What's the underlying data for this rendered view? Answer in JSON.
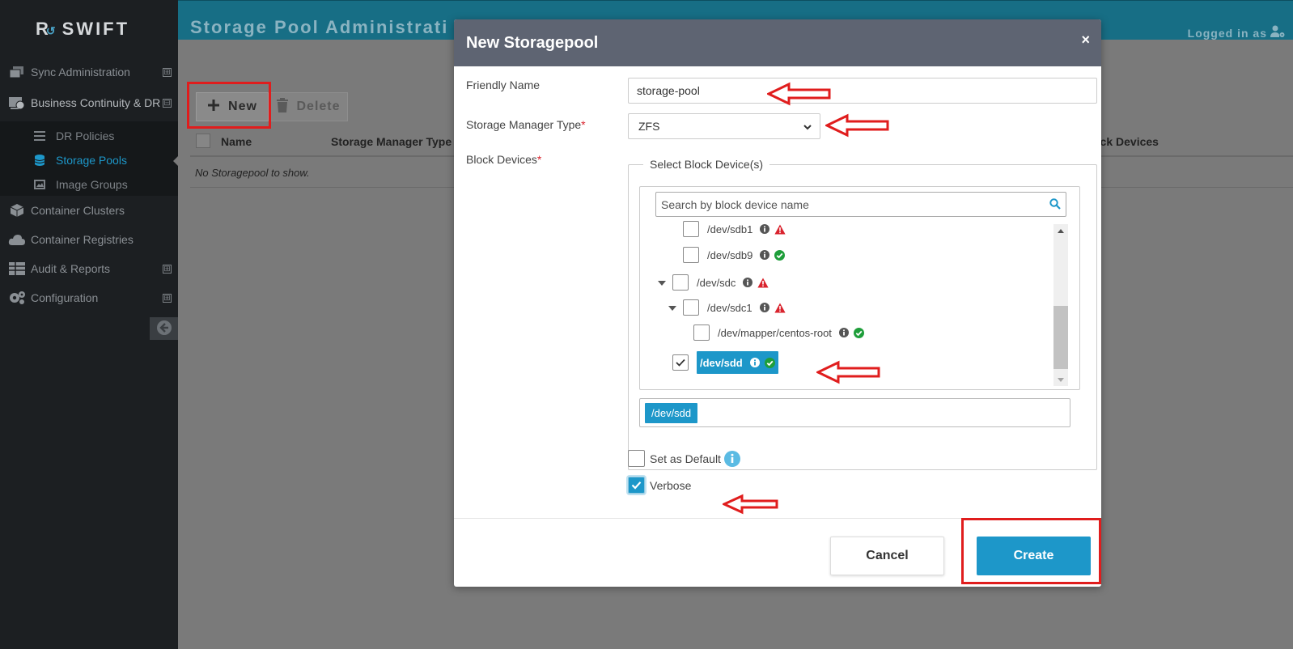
{
  "app": {
    "logo_text": "SWIFT",
    "logo_mark": "R"
  },
  "sidebar": {
    "items": [
      {
        "label": "Sync Administration",
        "expander": "⊞"
      },
      {
        "label": "Business Continuity & DR",
        "expander": "⊟"
      },
      {
        "label": "Container Clusters"
      },
      {
        "label": "Container Registries"
      },
      {
        "label": "Audit & Reports",
        "expander": "⊞"
      },
      {
        "label": "Configuration",
        "expander": "⊞"
      }
    ],
    "sub_items": [
      {
        "label": "DR Policies"
      },
      {
        "label": "Storage Pools",
        "active": true
      },
      {
        "label": "Image Groups"
      }
    ]
  },
  "header": {
    "title": "Storage Pool Administrati",
    "logged_in": "Logged in as"
  },
  "toolbar": {
    "new_label": "New",
    "delete_label": "Delete"
  },
  "grid": {
    "columns": [
      "Name",
      "Storage Manager Type",
      "ock Devices"
    ],
    "empty_text": "No Storagepool to show."
  },
  "modal": {
    "title": "New Storagepool",
    "close": "×",
    "friendly_name_label": "Friendly Name",
    "friendly_name_value": "storage-pool",
    "storage_manager_type_label": "Storage Manager Type",
    "storage_manager_type_value": "ZFS",
    "block_devices_label": "Block Devices",
    "required_mark": "*",
    "select_block_devices_legend": "Select Block Device(s)",
    "search_placeholder": "Search by block device name",
    "tree": [
      {
        "label": "/dev/sdb1",
        "status": "warning",
        "checked": false
      },
      {
        "label": "/dev/sdb9",
        "status": "ok",
        "checked": false
      },
      {
        "label": "/dev/sdc",
        "status": "warning",
        "checked": false
      },
      {
        "label": "/dev/sdc1",
        "status": "warning",
        "checked": false
      },
      {
        "label": "/dev/mapper/centos-root",
        "status": "ok",
        "checked": false
      },
      {
        "label": "/dev/sdd",
        "status": "ok",
        "checked": true
      }
    ],
    "selected_chip": "/dev/sdd",
    "set_as_default_label": "Set as Default",
    "set_as_default_checked": false,
    "verbose_label": "Verbose",
    "verbose_checked": true,
    "cancel_label": "Cancel",
    "create_label": "Create"
  },
  "colors": {
    "accent": "#1d97c9",
    "topbar": "#176e85",
    "sidebar": "#1c1f22",
    "modal_header": "#5e6472",
    "annotation_red": "#e01d1d",
    "status_ok": "#1e9e3a",
    "status_warning": "#d9232d"
  },
  "icons": {
    "status_ok": "check-circle-icon",
    "status_warning": "warning-triangle-icon",
    "info": "info-circle-icon"
  }
}
